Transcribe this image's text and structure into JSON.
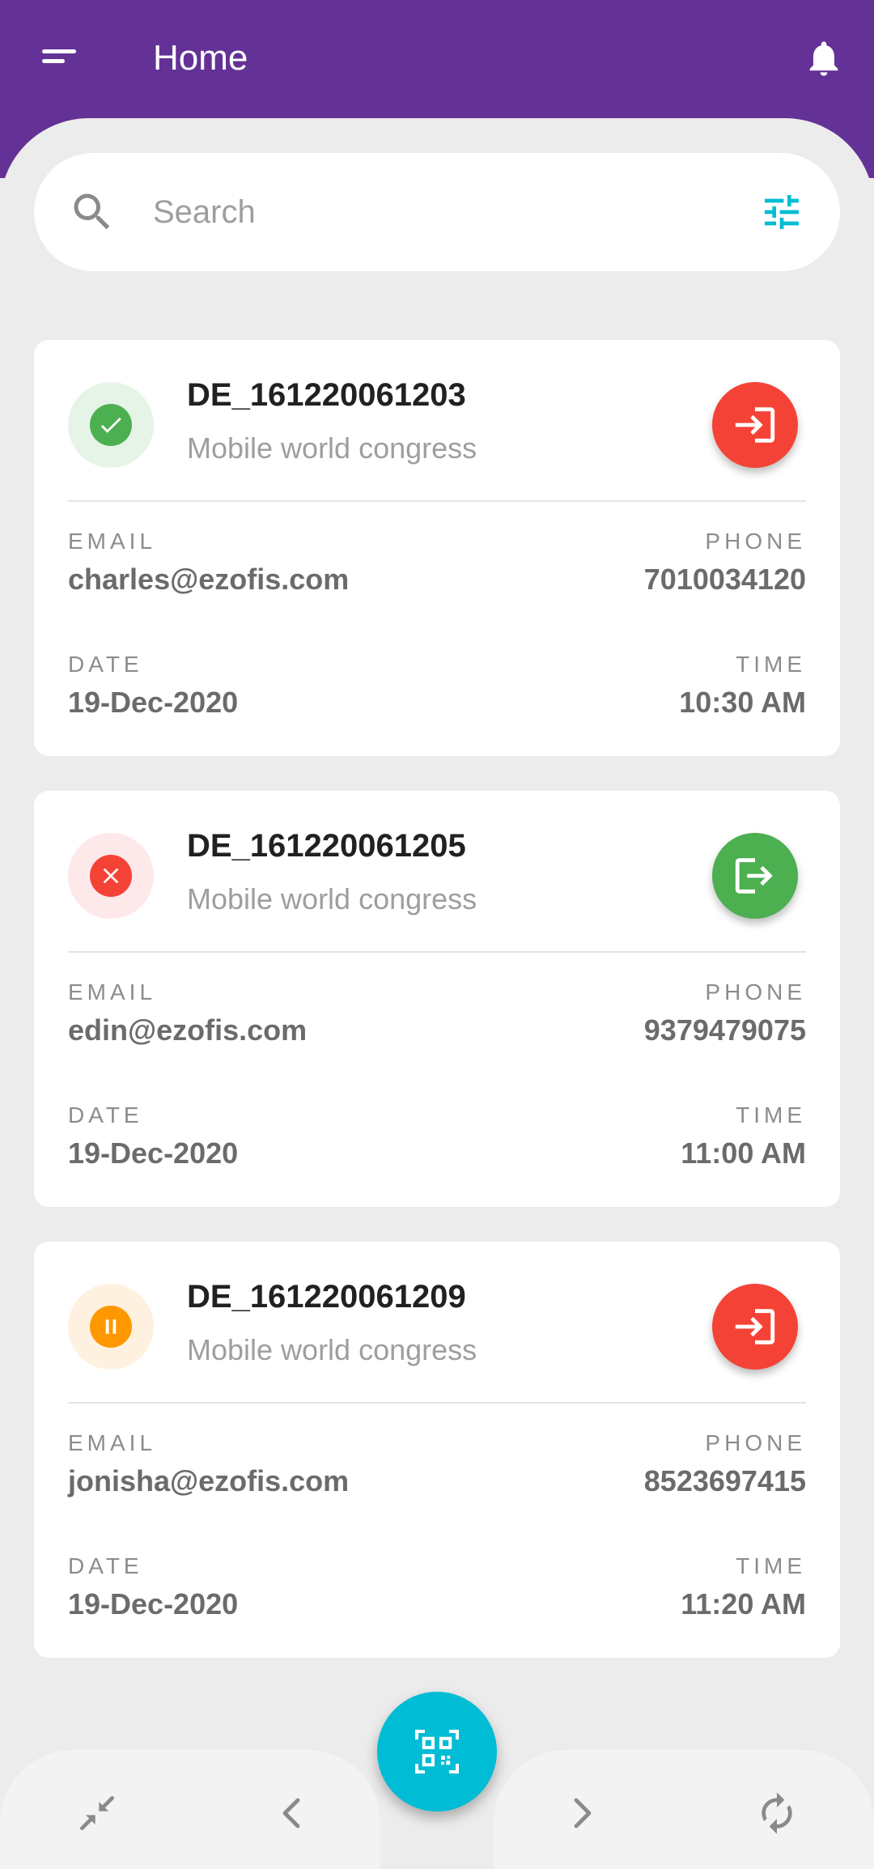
{
  "header": {
    "title": "Home",
    "background": "#643296"
  },
  "search": {
    "placeholder": "Search"
  },
  "icons": {
    "menu": "menu-icon",
    "bell": "bell-icon",
    "search": "search-icon",
    "filter": "tune-icon",
    "check_in": "login-icon",
    "check_out": "logout-icon",
    "collapse": "collapse-icon",
    "prev": "chevron-left-icon",
    "next": "chevron-right-icon",
    "refresh": "refresh-icon",
    "qr": "qr-scan-icon"
  },
  "labels": {
    "email": "EMAIL",
    "phone": "PHONE",
    "date": "DATE",
    "time": "TIME"
  },
  "cards": [
    {
      "id": "DE_161220061203",
      "event": "Mobile world congress",
      "status": "approved",
      "action": "check-in",
      "email": "charles@ezofis.com",
      "phone": "7010034120",
      "date": "19-Dec-2020",
      "time": "10:30 AM"
    },
    {
      "id": "DE_161220061205",
      "event": "Mobile world congress",
      "status": "rejected",
      "action": "check-out",
      "email": "edin@ezofis.com",
      "phone": "9379479075",
      "date": "19-Dec-2020",
      "time": "11:00 AM"
    },
    {
      "id": "DE_161220061209",
      "event": "Mobile world congress",
      "status": "paused",
      "action": "check-in",
      "email": "jonisha@ezofis.com",
      "phone": "8523697415",
      "date": "19-Dec-2020",
      "time": "11:20 AM"
    }
  ],
  "colors": {
    "approved": "#4caf50",
    "approved_bg": "#e6f4e7",
    "rejected": "#f44336",
    "rejected_bg": "#fde8ea",
    "paused": "#ff9800",
    "paused_bg": "#fff1e0",
    "check_in": "#f44336",
    "check_out": "#4caf50",
    "accent": "#00bcd4"
  }
}
